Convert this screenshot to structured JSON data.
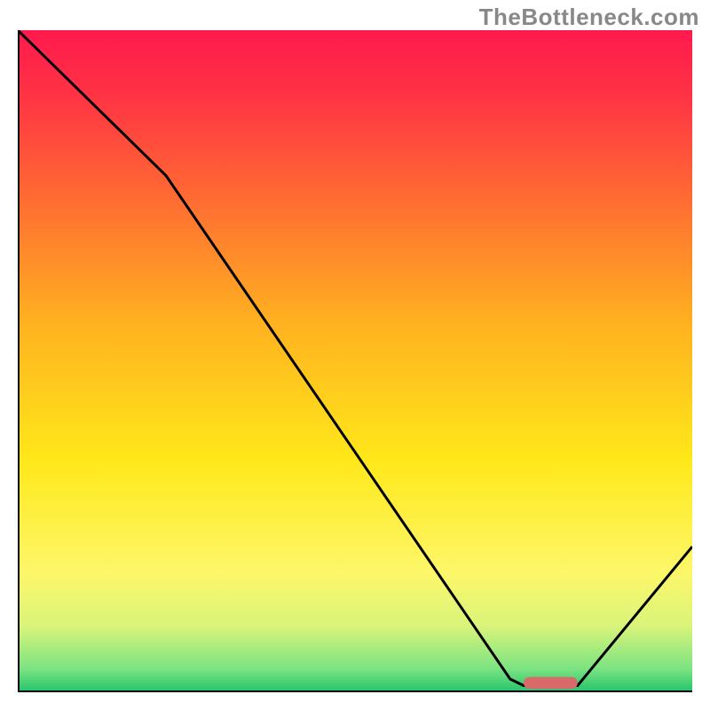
{
  "watermark": "TheBottleneck.com",
  "chart_data": {
    "type": "line",
    "title": "",
    "xlabel": "",
    "ylabel": "",
    "xlim": [
      0,
      100
    ],
    "ylim": [
      0,
      100
    ],
    "x_opt_range": [
      75,
      83
    ],
    "curve": [
      {
        "x": 0,
        "y": 100
      },
      {
        "x": 22,
        "y": 78
      },
      {
        "x": 73,
        "y": 2
      },
      {
        "x": 75,
        "y": 1
      },
      {
        "x": 83,
        "y": 1
      },
      {
        "x": 100,
        "y": 22
      }
    ],
    "gradient_stops": [
      {
        "offset": 0.0,
        "color": "#ff1a4d"
      },
      {
        "offset": 0.1,
        "color": "#ff3344"
      },
      {
        "offset": 0.25,
        "color": "#ff6a33"
      },
      {
        "offset": 0.45,
        "color": "#ffb41f"
      },
      {
        "offset": 0.65,
        "color": "#ffe81a"
      },
      {
        "offset": 0.82,
        "color": "#fdf76a"
      },
      {
        "offset": 0.9,
        "color": "#d9f47a"
      },
      {
        "offset": 0.965,
        "color": "#7be382"
      },
      {
        "offset": 1.0,
        "color": "#21c36a"
      }
    ],
    "marker_color": "#d96a6a",
    "marker_y_norm": 0.986,
    "marker_height_norm": 0.018,
    "marker_radius_norm": 0.009
  }
}
